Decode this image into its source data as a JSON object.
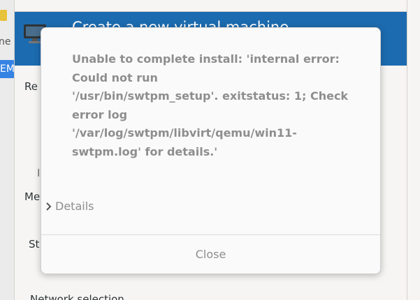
{
  "background": {
    "left_strip": {
      "text_top": "ne",
      "text_highlight": "EM"
    },
    "wizard": {
      "banner_title": "Create a new virtual machine",
      "labels": {
        "re": "Re",
        "me": "Me",
        "st": "St",
        "i1": "I",
        "i2": "I"
      },
      "network_selection": "Network selection"
    }
  },
  "dialog": {
    "message": "Unable to complete install: 'internal error:\nCould not run\n'/usr/bin/swtpm_setup'. exitstatus: 1; Check\nerror log\n'/var/log/swtpm/libvirt/qemu/win11-\nswtpm.log' for details.'",
    "details_label": "Details",
    "close_label": "Close"
  },
  "colors": {
    "banner": "#1c6bb0",
    "dialog_text": "#8e8e8e",
    "dialog_bg": "#fafafa"
  },
  "icons": {
    "details": "chevron-right-icon",
    "banner": "monitor-icon"
  }
}
